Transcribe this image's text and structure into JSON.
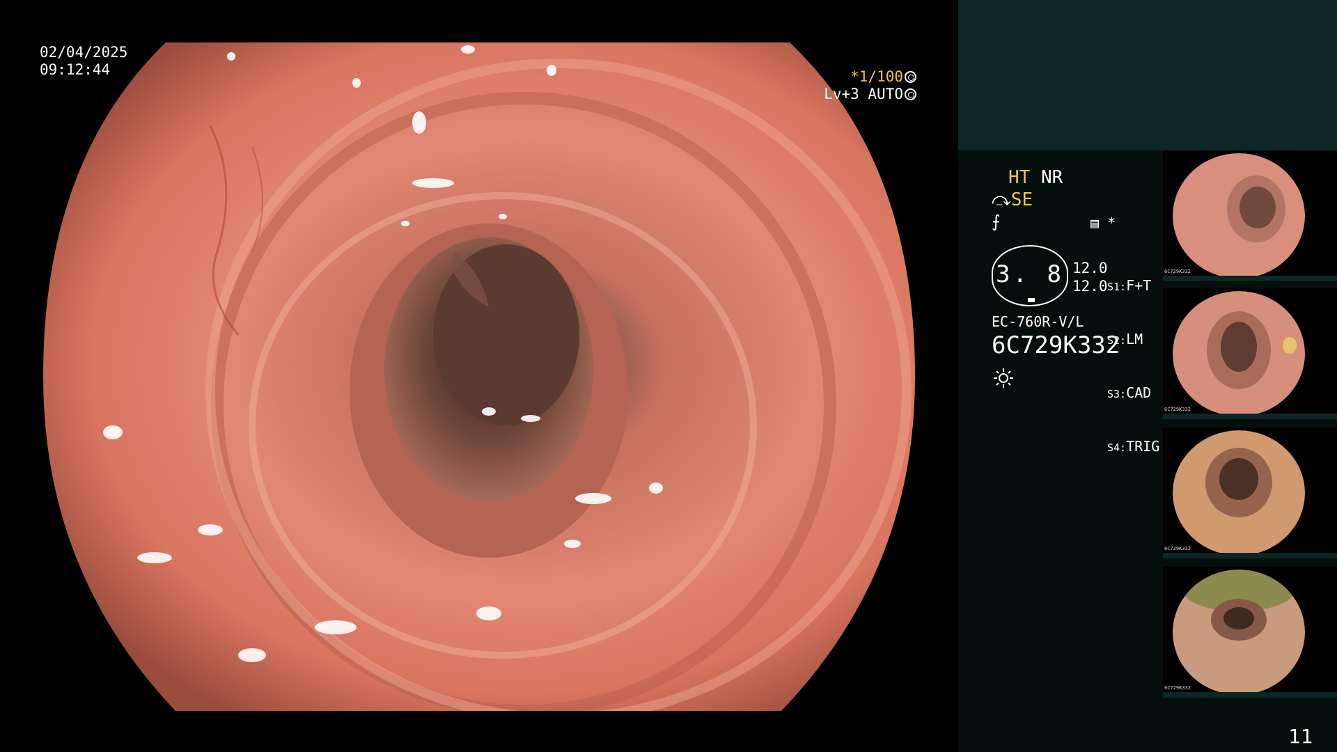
{
  "endoscope": {
    "date": "02/04/2025",
    "time": "09:12:44",
    "shutter_prefix": "*1/100",
    "level": "Lv+3 AUTO"
  },
  "info_panel": {
    "ht": "HT",
    "nr": "NR",
    "se_icon": "contrast-icon",
    "se": "SE",
    "ice_icon": "zoom-icon",
    "memo_mark": "*",
    "gauge_value": "3. 8",
    "vals": [
      "12.0",
      "12.0"
    ],
    "settings": [
      {
        "key": "S1:",
        "value": "F+T"
      },
      {
        "key": "S2:",
        "value": "LM"
      },
      {
        "key": "S3:",
        "value": "CAD"
      },
      {
        "key": "S4:",
        "value": "TRIG"
      }
    ],
    "model": "EC-760R-V/L",
    "serial": "6C729K332",
    "light_icon": "sun-icon"
  },
  "thumbnails": [
    {
      "label": "6C729K332"
    },
    {
      "label": "6C729K332"
    },
    {
      "label": "6C729K332"
    },
    {
      "label": "6C729K332"
    }
  ],
  "page_number": "11",
  "colors": {
    "panel_top": "#0b2625",
    "panel_bg": "#040e0c",
    "accent_yellow": "#f4c542"
  }
}
